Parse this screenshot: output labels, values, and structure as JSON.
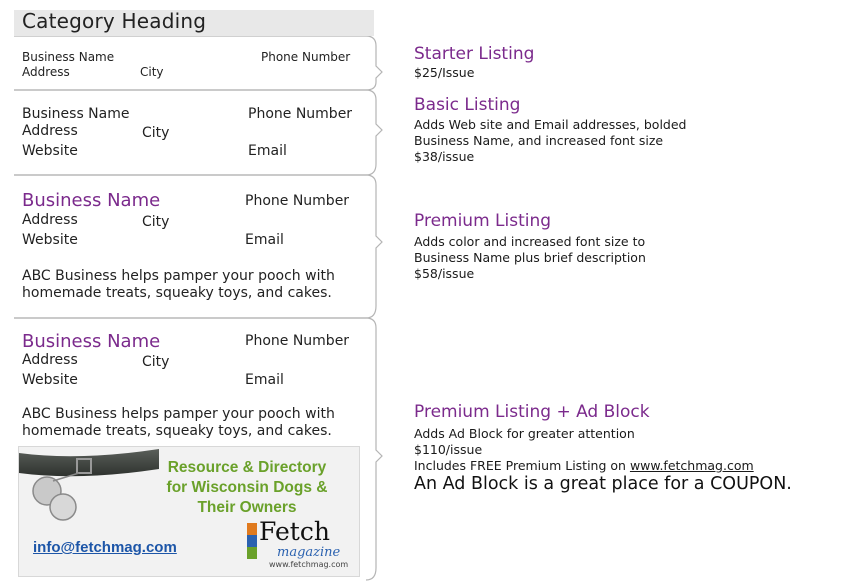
{
  "category_heading": "Category Heading",
  "starter_sample": {
    "name": "Business Name",
    "phone": "Phone Number",
    "address": "Address",
    "city": "City"
  },
  "basic_sample": {
    "name": "Business Name",
    "phone": "Phone Number",
    "address": "Address",
    "city": "City",
    "website": "Website",
    "email": "Email"
  },
  "premium_sample": {
    "name": "Business Name",
    "phone": "Phone Number",
    "address": "Address",
    "city": "City",
    "website": "Website",
    "email": "Email",
    "description_line1": "ABC Business helps pamper your pooch with",
    "description_line2": "homemade treats, squeaky toys, and cakes."
  },
  "premium_ad_sample": {
    "name": "Business Name",
    "phone": "Phone Number",
    "address": "Address",
    "city": "City",
    "website": "Website",
    "email": "Email",
    "description_line1": "ABC Business helps pamper your pooch with",
    "description_line2": "homemade treats, squeaky toys, and cakes."
  },
  "ad_block": {
    "line1": "Resource & Directory",
    "line2": "for Wisconsin Dogs &",
    "line3": "Their Owners",
    "email": "info@fetchmag.com",
    "logo_word": "Fetch",
    "logo_sub": "magazine",
    "logo_url": "www.fetchmag.com"
  },
  "tiers": {
    "starter": {
      "title": "Starter Listing",
      "price": "$25/Issue"
    },
    "basic": {
      "title": "Basic Listing",
      "desc_line1": "Adds Web site and Email addresses, bolded",
      "desc_line2": "Business Name, and increased font size",
      "price": "$38/issue"
    },
    "premium": {
      "title": "Premium Listing",
      "desc_line1": "Adds color and increased font size to",
      "desc_line2": "Business Name plus brief description",
      "price": "$58/issue"
    },
    "premium_ad": {
      "title": "Premium Listing + Ad Block",
      "desc_line1": "Adds Ad Block for greater attention",
      "price": "$110/issue",
      "free_text": "Includes FREE Premium Listing on ",
      "free_link": "www.fetchmag.com",
      "coupon": "An Ad Block is a great place for a COUPON."
    }
  },
  "colors": {
    "accent_purple": "#7b2a8c",
    "ad_green": "#6aa12a",
    "link_blue": "#1d56a8"
  }
}
